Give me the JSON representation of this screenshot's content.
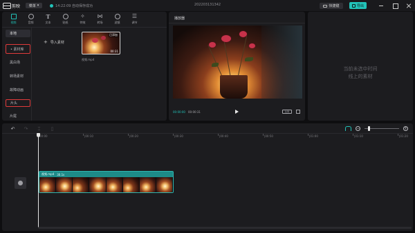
{
  "titlebar": {
    "app_name": "剪映",
    "menu_label": "菜单",
    "save_status": "14:22:09 自动保存成功",
    "project_name": "202203131342",
    "shortcut_label": "快捷键",
    "export_label": "导出"
  },
  "toolbar": {
    "tools": [
      {
        "label": "视频",
        "icon": "video-media-icon"
      },
      {
        "label": "音频",
        "icon": "audio-icon"
      },
      {
        "label": "文本",
        "icon": "text-icon"
      },
      {
        "label": "贴纸",
        "icon": "sticker-icon"
      },
      {
        "label": "特效",
        "icon": "effects-icon"
      },
      {
        "label": "转场",
        "icon": "transition-icon"
      },
      {
        "label": "滤镜",
        "icon": "filter-icon"
      },
      {
        "label": "调节",
        "icon": "adjust-icon"
      }
    ]
  },
  "sidebar": {
    "items": [
      {
        "label": "本地"
      },
      {
        "label": "• 素材库"
      },
      {
        "label": "黑白场"
      },
      {
        "label": "转场素材"
      },
      {
        "label": "故障动画"
      },
      {
        "label": "片头"
      },
      {
        "label": "片尾"
      }
    ]
  },
  "media": {
    "import_label": "导入素材",
    "thumb_added": "已添加",
    "thumb_duration": "00:31",
    "filename": "视频.mp4"
  },
  "player": {
    "title": "播放器",
    "current_time": "00:00:00",
    "total_time": "00:00:31",
    "ratio_label": "比例"
  },
  "detail": {
    "empty_text_line1": "当前未选中时间",
    "empty_text_line2": "线上的素材"
  },
  "timeline": {
    "ruler_ticks": [
      "00:00",
      "|00:10",
      "|00:20",
      "|00:30",
      "|00:40",
      "|00:50",
      "|01:00",
      "|01:10",
      "|01:20"
    ],
    "clip_name": "视频.mp4",
    "clip_duration": "30.1s",
    "zoom_level": 0.1
  },
  "colors": {
    "accent": "#22c3b9",
    "highlight_border": "#e23b3b",
    "background": "#0e0e10",
    "panel": "#1c1c1f"
  }
}
